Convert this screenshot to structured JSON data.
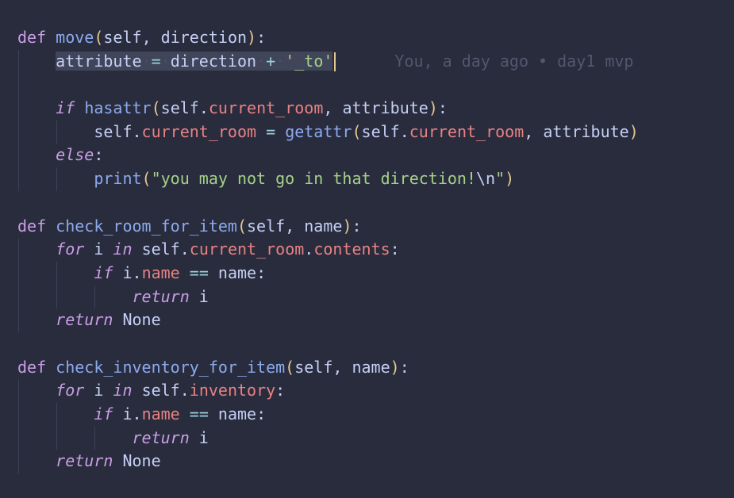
{
  "editor": {
    "inline_blame": "You, a day ago • day1 mvp",
    "lines": [
      {
        "indent": 0,
        "tokens": [
          {
            "t": "def",
            "c": "kw"
          },
          {
            "t": " "
          },
          {
            "t": "move",
            "c": "fn"
          },
          {
            "t": "(",
            "c": "p1"
          },
          {
            "t": "self",
            "c": "self"
          },
          {
            "t": ", ",
            "c": "punc"
          },
          {
            "t": "direction",
            "c": "param"
          },
          {
            "t": ")",
            "c": "p1"
          },
          {
            "t": ":",
            "c": "punc"
          }
        ]
      },
      {
        "indent": 1,
        "current": true,
        "blame": true,
        "tokens": [
          {
            "t": "attribute",
            "c": "plain",
            "sel": true
          },
          {
            "t": "·",
            "c": "ws",
            "sel": true
          },
          {
            "t": "=",
            "c": "op",
            "sel": true
          },
          {
            "t": "·",
            "c": "ws",
            "sel": true
          },
          {
            "t": "direction",
            "c": "plain",
            "sel": true
          },
          {
            "t": "·",
            "c": "ws",
            "sel": true
          },
          {
            "t": "+",
            "c": "op",
            "sel": true
          },
          {
            "t": "·",
            "c": "ws",
            "sel": true
          },
          {
            "t": "'_to'",
            "c": "str",
            "sel": true
          }
        ]
      },
      {
        "indent": 1,
        "tokens": []
      },
      {
        "indent": 1,
        "tokens": [
          {
            "t": "if",
            "c": "kw it"
          },
          {
            "t": " "
          },
          {
            "t": "hasattr",
            "c": "fn"
          },
          {
            "t": "(",
            "c": "p1"
          },
          {
            "t": "self",
            "c": "self"
          },
          {
            "t": ".",
            "c": "punc"
          },
          {
            "t": "current_room",
            "c": "attr"
          },
          {
            "t": ", ",
            "c": "punc"
          },
          {
            "t": "attribute",
            "c": "plain"
          },
          {
            "t": ")",
            "c": "p1"
          },
          {
            "t": ":",
            "c": "punc"
          }
        ]
      },
      {
        "indent": 2,
        "tokens": [
          {
            "t": "self",
            "c": "self"
          },
          {
            "t": ".",
            "c": "punc"
          },
          {
            "t": "current_room",
            "c": "attr"
          },
          {
            "t": " "
          },
          {
            "t": "=",
            "c": "op"
          },
          {
            "t": " "
          },
          {
            "t": "getattr",
            "c": "fn"
          },
          {
            "t": "(",
            "c": "p1"
          },
          {
            "t": "self",
            "c": "self"
          },
          {
            "t": ".",
            "c": "punc"
          },
          {
            "t": "current_room",
            "c": "attr"
          },
          {
            "t": ", ",
            "c": "punc"
          },
          {
            "t": "attribute",
            "c": "plain"
          },
          {
            "t": ")",
            "c": "p1"
          }
        ]
      },
      {
        "indent": 1,
        "tokens": [
          {
            "t": "else",
            "c": "kw it"
          },
          {
            "t": ":",
            "c": "punc"
          }
        ]
      },
      {
        "indent": 2,
        "tokens": [
          {
            "t": "print",
            "c": "fn"
          },
          {
            "t": "(",
            "c": "p1"
          },
          {
            "t": "\"you may not go in that direction!",
            "c": "str"
          },
          {
            "t": "\\n",
            "c": "esc"
          },
          {
            "t": "\"",
            "c": "str"
          },
          {
            "t": ")",
            "c": "p1"
          }
        ]
      },
      {
        "indent": 0,
        "tokens": []
      },
      {
        "indent": 0,
        "tokens": [
          {
            "t": "def",
            "c": "kw"
          },
          {
            "t": " "
          },
          {
            "t": "check_room_for_item",
            "c": "fn"
          },
          {
            "t": "(",
            "c": "p1"
          },
          {
            "t": "self",
            "c": "self"
          },
          {
            "t": ", ",
            "c": "punc"
          },
          {
            "t": "name",
            "c": "param"
          },
          {
            "t": ")",
            "c": "p1"
          },
          {
            "t": ":",
            "c": "punc"
          }
        ]
      },
      {
        "indent": 1,
        "tokens": [
          {
            "t": "for",
            "c": "kw it"
          },
          {
            "t": " i "
          },
          {
            "t": "in",
            "c": "kw it"
          },
          {
            "t": " "
          },
          {
            "t": "self",
            "c": "self"
          },
          {
            "t": ".",
            "c": "punc"
          },
          {
            "t": "current_room",
            "c": "attr"
          },
          {
            "t": ".",
            "c": "punc"
          },
          {
            "t": "contents",
            "c": "attr"
          },
          {
            "t": ":",
            "c": "punc"
          }
        ]
      },
      {
        "indent": 2,
        "tokens": [
          {
            "t": "if",
            "c": "kw it"
          },
          {
            "t": " i"
          },
          {
            "t": ".",
            "c": "punc"
          },
          {
            "t": "name",
            "c": "attr"
          },
          {
            "t": " "
          },
          {
            "t": "==",
            "c": "op"
          },
          {
            "t": " name"
          },
          {
            "t": ":",
            "c": "punc"
          }
        ]
      },
      {
        "indent": 3,
        "tokens": [
          {
            "t": "return",
            "c": "kw it"
          },
          {
            "t": " i"
          }
        ]
      },
      {
        "indent": 1,
        "tokens": [
          {
            "t": "return",
            "c": "kw it"
          },
          {
            "t": " "
          },
          {
            "t": "None",
            "c": "none"
          }
        ]
      },
      {
        "indent": 0,
        "tokens": []
      },
      {
        "indent": 0,
        "tokens": [
          {
            "t": "def",
            "c": "kw"
          },
          {
            "t": " "
          },
          {
            "t": "check_inventory_for_item",
            "c": "fn"
          },
          {
            "t": "(",
            "c": "p1"
          },
          {
            "t": "self",
            "c": "self"
          },
          {
            "t": ", ",
            "c": "punc"
          },
          {
            "t": "name",
            "c": "param"
          },
          {
            "t": ")",
            "c": "p1"
          },
          {
            "t": ":",
            "c": "punc"
          }
        ]
      },
      {
        "indent": 1,
        "tokens": [
          {
            "t": "for",
            "c": "kw it"
          },
          {
            "t": " i "
          },
          {
            "t": "in",
            "c": "kw it"
          },
          {
            "t": " "
          },
          {
            "t": "self",
            "c": "self"
          },
          {
            "t": ".",
            "c": "punc"
          },
          {
            "t": "inventory",
            "c": "attr"
          },
          {
            "t": ":",
            "c": "punc"
          }
        ]
      },
      {
        "indent": 2,
        "tokens": [
          {
            "t": "if",
            "c": "kw it"
          },
          {
            "t": " i"
          },
          {
            "t": ".",
            "c": "punc"
          },
          {
            "t": "name",
            "c": "attr"
          },
          {
            "t": " "
          },
          {
            "t": "==",
            "c": "op"
          },
          {
            "t": " name"
          },
          {
            "t": ":",
            "c": "punc"
          }
        ]
      },
      {
        "indent": 3,
        "tokens": [
          {
            "t": "return",
            "c": "kw it"
          },
          {
            "t": " i"
          }
        ]
      },
      {
        "indent": 1,
        "tokens": [
          {
            "t": "return",
            "c": "kw it"
          },
          {
            "t": " "
          },
          {
            "t": "None",
            "c": "none"
          }
        ]
      }
    ]
  },
  "colors": {
    "background": "#292c3d",
    "keyword": "#ca9ee6",
    "function": "#8caaee",
    "attribute": "#e78284",
    "string": "#a6d189",
    "operator": "#99d1db",
    "bracket": "#e5c890",
    "blame": "#51576d"
  }
}
